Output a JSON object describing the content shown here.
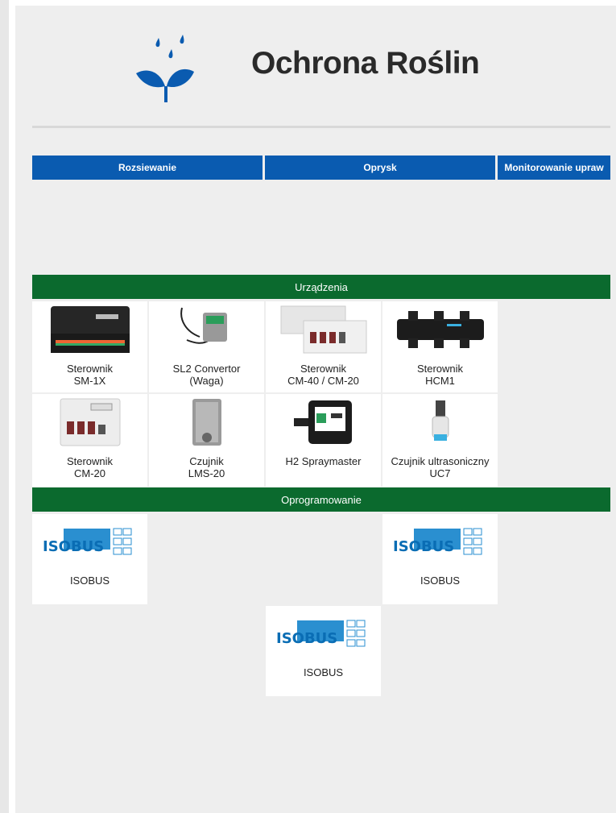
{
  "header": {
    "title": "Ochrona Roślin",
    "logo_icon": "plant-drops-icon"
  },
  "tabs": [
    {
      "label": "Rozsiewanie"
    },
    {
      "label": "Oprysk"
    },
    {
      "label": "Monitorowanie upraw"
    }
  ],
  "devices": {
    "title": "Urządzenia",
    "items": [
      {
        "line1": "Sterownik",
        "line2": "SM-1X",
        "icon": "controller-sm1x-image"
      },
      {
        "line1": "SL2 Convertor",
        "line2": "(Waga)",
        "icon": "sl2-convertor-image"
      },
      {
        "line1": "Sterownik",
        "line2": "CM-40 / CM-20",
        "icon": "controller-cm40-image"
      },
      {
        "line1": "Sterownik",
        "line2": "HCM1",
        "icon": "controller-hcm1-image"
      },
      {
        "line1": "Sterownik",
        "line2": "CM-20",
        "icon": "controller-cm20-image"
      },
      {
        "line1": "Czujnik",
        "line2": "LMS-20",
        "icon": "sensor-lms20-image"
      },
      {
        "line1": "H2 Spraymaster",
        "line2": "",
        "icon": "h2-spraymaster-image"
      },
      {
        "line1": "Czujnik ultrasoniczny",
        "line2": "UC7",
        "icon": "ultrasonic-sensor-image"
      }
    ]
  },
  "software": {
    "title": "Oprogramowanie",
    "items": [
      {
        "label": "ISOBUS",
        "logo_text": "ISOBUS"
      },
      {
        "label": "ISOBUS",
        "logo_text": "ISOBUS"
      },
      {
        "label": "ISOBUS",
        "logo_text": "ISOBUS"
      }
    ]
  },
  "colors": {
    "tab_blue": "#0a5bb0",
    "section_green": "#0b6a2e",
    "background": "#eeeeee"
  }
}
